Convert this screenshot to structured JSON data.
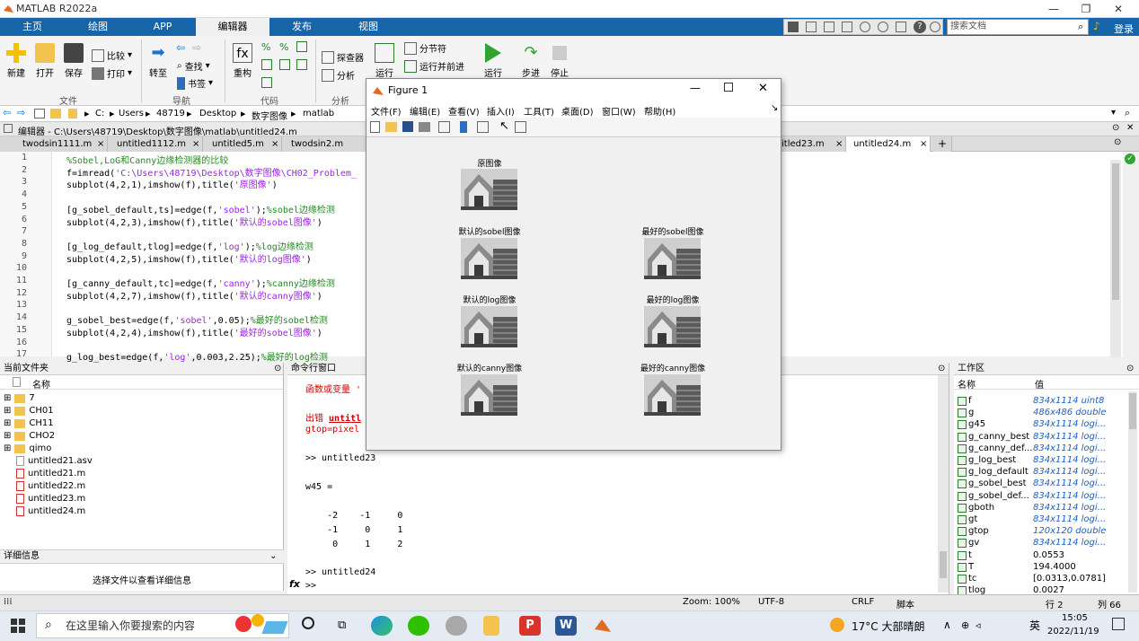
{
  "app": {
    "title": "MATLAB R2022a"
  },
  "window_controls": [
    "—",
    "❐",
    "✕"
  ],
  "ribbon_tabs": [
    "主页",
    "绘图",
    "APP",
    "编辑器",
    "发布",
    "视图"
  ],
  "search_placeholder": "搜索文档",
  "login": "登录",
  "toolstrip": {
    "new": "新建",
    "open": "打开",
    "save": "保存",
    "compare": "比较",
    "print": "打印",
    "goto": "转至",
    "find": "查找",
    "bookmark": "书签",
    "refactor": "重构",
    "profiler": "探查器",
    "analyze": "分析",
    "run_section_small": "运行",
    "section_break": "分节符",
    "run_and_advance": "运行并前进",
    "run": "运行",
    "step": "步进",
    "stop": "停止",
    "groups": {
      "file": "文件",
      "navigate": "导航",
      "code": "代码",
      "analyze": "分析"
    }
  },
  "address": [
    "C:",
    "Users",
    "48719",
    "Desktop",
    "数字图像",
    "matlab"
  ],
  "editor_path": "编辑器 - C:\\Users\\48719\\Desktop\\数字图像\\matlab\\untitled24.m",
  "file_tabs": [
    "twodsin1111.m",
    "untitled1112.m",
    "untitled5.m",
    "twodsin2.m",
    "itled23.m",
    "untitled24.m"
  ],
  "code": [
    {
      "n": "1",
      "parts": [
        {
          "t": "%Sobel,LoG和Canny边缘检测器的比较",
          "c": "cm"
        }
      ]
    },
    {
      "n": "2",
      "parts": [
        {
          "t": "f=imread(",
          "c": ""
        },
        {
          "t": "'C:\\Users\\48719\\Desktop\\数字图像\\CH02_Problem_",
          "c": "str"
        }
      ]
    },
    {
      "n": "3",
      "parts": [
        {
          "t": "subplot(4,2,1),imshow(f),title(",
          "c": ""
        },
        {
          "t": "'原图像'",
          "c": "str"
        },
        {
          "t": ")",
          "c": ""
        }
      ]
    },
    {
      "n": "4",
      "parts": []
    },
    {
      "n": "5",
      "parts": [
        {
          "t": "[g_sobel_default,ts]=edge(f,",
          "c": ""
        },
        {
          "t": "'sobel'",
          "c": "str"
        },
        {
          "t": ");",
          "c": ""
        },
        {
          "t": "%sobel边缘检测",
          "c": "cm"
        }
      ]
    },
    {
      "n": "6",
      "parts": [
        {
          "t": "subplot(4,2,3),imshow(f),title(",
          "c": ""
        },
        {
          "t": "'默认的sobel图像'",
          "c": "str"
        },
        {
          "t": ")",
          "c": ""
        }
      ]
    },
    {
      "n": "7",
      "parts": []
    },
    {
      "n": "8",
      "parts": [
        {
          "t": "[g_log_default,tlog]=edge(f,",
          "c": ""
        },
        {
          "t": "'log'",
          "c": "str"
        },
        {
          "t": ");",
          "c": ""
        },
        {
          "t": "%log边缘检测",
          "c": "cm"
        }
      ]
    },
    {
      "n": "9",
      "parts": [
        {
          "t": "subplot(4,2,5),imshow(f),title(",
          "c": ""
        },
        {
          "t": "'默认的log图像'",
          "c": "str"
        },
        {
          "t": ")",
          "c": ""
        }
      ]
    },
    {
      "n": "10",
      "parts": []
    },
    {
      "n": "11",
      "parts": [
        {
          "t": "[g_canny_default,tc]=edge(f,",
          "c": ""
        },
        {
          "t": "'canny'",
          "c": "str"
        },
        {
          "t": ");",
          "c": ""
        },
        {
          "t": "%canny边缘检测",
          "c": "cm"
        }
      ]
    },
    {
      "n": "12",
      "parts": [
        {
          "t": "subplot(4,2,7),imshow(f),title(",
          "c": ""
        },
        {
          "t": "'默认的canny图像'",
          "c": "str"
        },
        {
          "t": ")",
          "c": ""
        }
      ]
    },
    {
      "n": "13",
      "parts": []
    },
    {
      "n": "14",
      "parts": [
        {
          "t": "g_sobel_best=edge(f,",
          "c": ""
        },
        {
          "t": "'sobel'",
          "c": "str"
        },
        {
          "t": ",0.05);",
          "c": ""
        },
        {
          "t": "%最好的sobel检测",
          "c": "cm"
        }
      ]
    },
    {
      "n": "15",
      "parts": [
        {
          "t": "subplot(4,2,4),imshow(f),title(",
          "c": ""
        },
        {
          "t": "'最好的sobel图像'",
          "c": "str"
        },
        {
          "t": ")",
          "c": ""
        }
      ]
    },
    {
      "n": "16",
      "parts": []
    },
    {
      "n": "17",
      "parts": [
        {
          "t": "g_log_best=edge(f,",
          "c": ""
        },
        {
          "t": "'log'",
          "c": "str"
        },
        {
          "t": ",0.003,2.25);",
          "c": ""
        },
        {
          "t": "%最好的log检测",
          "c": "cm"
        }
      ]
    }
  ],
  "file_panel": {
    "title": "当前文件夹",
    "col_name": "名称",
    "folders": [
      "7",
      "CH01",
      "CH11",
      "CHO2",
      "qimo"
    ],
    "files": [
      "untitled21.asv",
      "untitled21.m",
      "untitled22.m",
      "untitled23.m",
      "untitled24.m"
    ],
    "details_title": "详细信息",
    "details_text": "选择文件以查看详细信息"
  },
  "cmd": {
    "title": "命令行窗口",
    "err1": "函数或变量 '",
    "err_prefix": "出错 ",
    "err_link": "untitl",
    "err2": "gtop=pixel",
    "prompt1": ">> untitled23",
    "w45": "w45 =",
    "rows": [
      "    -2    -1     0",
      "    -1     0     1",
      "     0     1     2"
    ],
    "prompt2": ">> untitled24",
    "prompt3": ">>",
    "fx": "fx"
  },
  "workspace": {
    "title": "工作区",
    "col_name": "名称",
    "col_value": "值",
    "vars": [
      {
        "name": "f",
        "value": "834x1114 uint8"
      },
      {
        "name": "g",
        "value": "486x486 double"
      },
      {
        "name": "g45",
        "value": "834x1114 logi..."
      },
      {
        "name": "g_canny_best",
        "value": "834x1114 logi..."
      },
      {
        "name": "g_canny_def...",
        "value": "834x1114 logi..."
      },
      {
        "name": "g_log_best",
        "value": "834x1114 logi..."
      },
      {
        "name": "g_log_default",
        "value": "834x1114 logi..."
      },
      {
        "name": "g_sobel_best",
        "value": "834x1114 logi..."
      },
      {
        "name": "g_sobel_def...",
        "value": "834x1114 logi..."
      },
      {
        "name": "gboth",
        "value": "834x1114 logi..."
      },
      {
        "name": "gt",
        "value": "834x1114 logi..."
      },
      {
        "name": "gtop",
        "value": "120x120 double"
      },
      {
        "name": "gv",
        "value": "834x1114 logi..."
      },
      {
        "name": "t",
        "value": "0.0553"
      },
      {
        "name": "T",
        "value": "194.4000"
      },
      {
        "name": "tc",
        "value": "[0.0313,0.0781]"
      },
      {
        "name": "tlog",
        "value": "0.0027"
      }
    ]
  },
  "status": {
    "zoom": "Zoom: 100%",
    "enc": "UTF-8",
    "eol": "CRLF",
    "type": "脚本",
    "row": "行 2",
    "col": "列 66"
  },
  "figure": {
    "title": "Figure 1",
    "menu": [
      "文件(F)",
      "编辑(E)",
      "查看(V)",
      "插入(I)",
      "工具(T)",
      "桌面(D)",
      "窗口(W)",
      "帮助(H)"
    ],
    "subplots": {
      "orig": "原图像",
      "sobel_default": "默认的sobel图像",
      "sobel_best": "最好的sobel图像",
      "log_default": "默认的log图像",
      "log_best": "最好的log图像",
      "canny_default": "默认的canny图像",
      "canny_best": "最好的canny图像"
    }
  },
  "taskbar": {
    "search": "在这里输入你要搜索的内容",
    "weather": "17°C 大部晴朗",
    "time": "15:05",
    "date": "2022/11/19",
    "lang": "英"
  }
}
